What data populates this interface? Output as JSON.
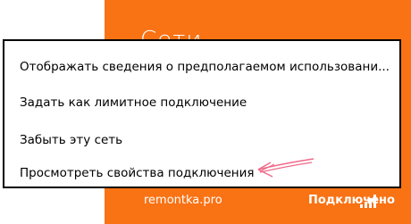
{
  "panel": {
    "title": "Сети",
    "network_name": "remontka.pro",
    "network_status": "Подключено",
    "accent_color": "#f97214",
    "signal_icon": "wifi-signal-icon"
  },
  "context_menu": {
    "items": [
      {
        "label": "Отображать сведения о предполагаемом использовани..."
      },
      {
        "label": "Задать как лимитное подключение"
      },
      {
        "label": "Забыть эту сеть"
      },
      {
        "label": "Просмотреть свойства подключения"
      }
    ]
  },
  "annotation": {
    "icon": "pink-arrow-icon",
    "color": "#f06a8a"
  }
}
